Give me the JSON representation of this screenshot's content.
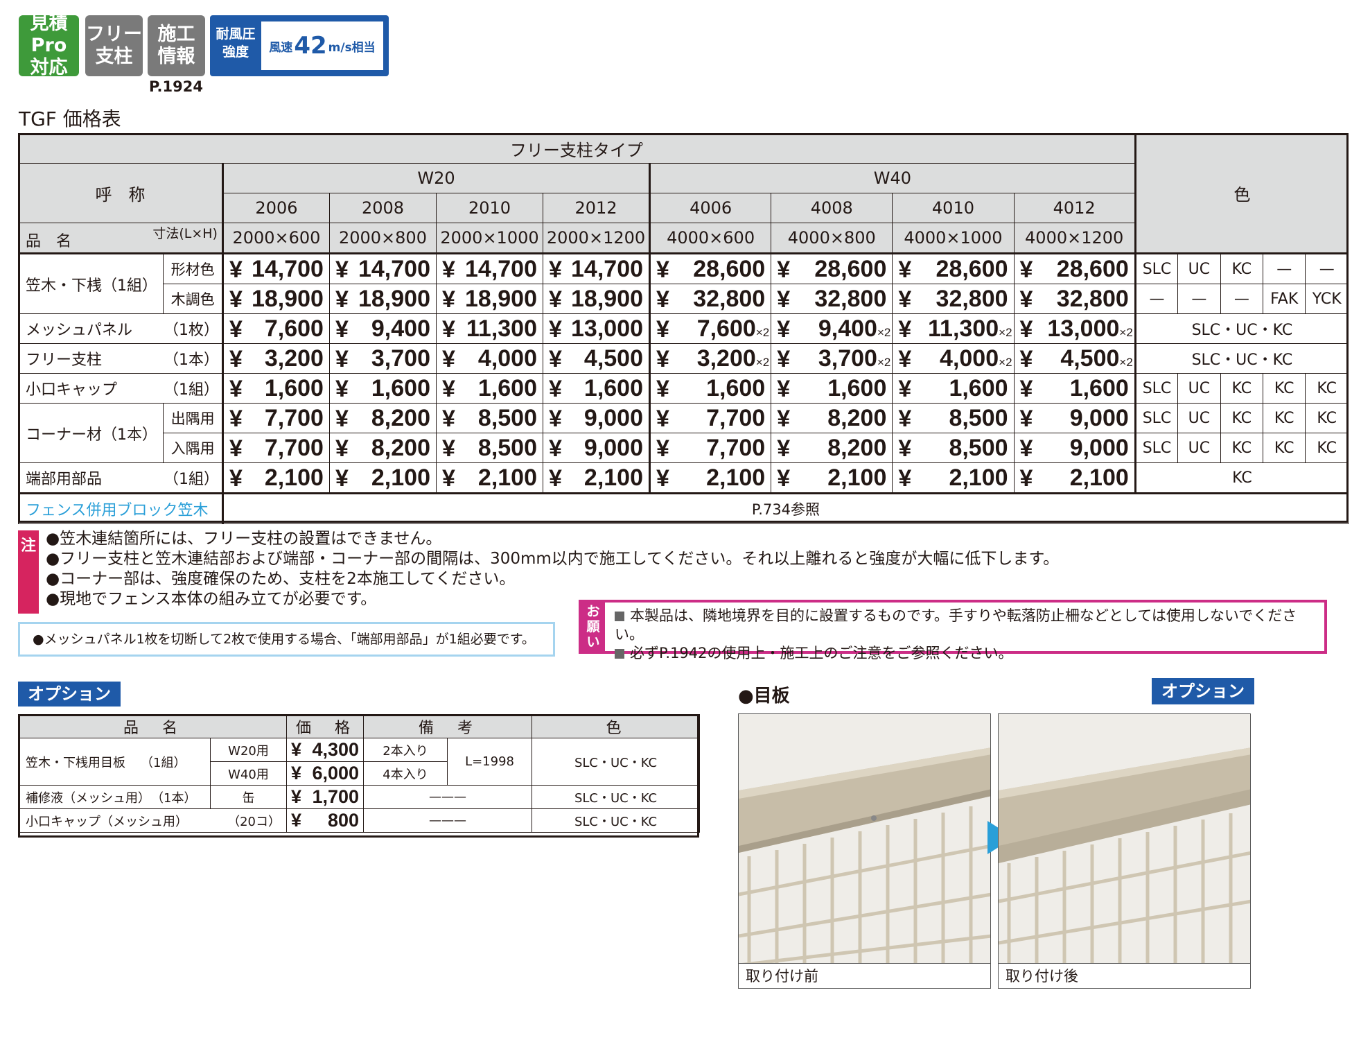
{
  "badges": {
    "mitsumori": "見積Pro\n対応",
    "free_post": "フリー\n支柱",
    "construction": "施工\n情報",
    "page_ref": "P.1924",
    "wind_label": "耐風圧\n強度",
    "wind_prefix": "風速",
    "wind_value": "42",
    "wind_suffix": "m/s相当"
  },
  "title": "TGF 価格表",
  "table": {
    "type_header": "フリー支柱タイプ",
    "name_header": "呼　称",
    "color_header": "色",
    "size_label": "寸法(L×H)",
    "item_label": "品　名",
    "groups": [
      "W20",
      "W40"
    ],
    "codes": [
      "2006",
      "2008",
      "2010",
      "2012",
      "4006",
      "4008",
      "4010",
      "4012"
    ],
    "sizes": [
      "2000×600",
      "2000×800",
      "2000×1000",
      "2000×1200",
      "4000×600",
      "4000×800",
      "4000×1000",
      "4000×1200"
    ],
    "yen": "¥",
    "x2": "×2",
    "rows": [
      {
        "name": "笠木・下桟（1組）",
        "sub": "形材色",
        "prices": [
          "14,700",
          "14,700",
          "14,700",
          "14,700",
          "28,600",
          "28,600",
          "28,600",
          "28,600"
        ],
        "colors": [
          "SLC",
          "UC",
          "KC",
          "—",
          "—"
        ]
      },
      {
        "name": "",
        "sub": "木調色",
        "prices": [
          "18,900",
          "18,900",
          "18,900",
          "18,900",
          "32,800",
          "32,800",
          "32,800",
          "32,800"
        ],
        "colors": [
          "—",
          "—",
          "—",
          "FAK",
          "YCK"
        ]
      },
      {
        "name": "メッシュパネル",
        "qty": "（1枚）",
        "prices": [
          "7,600",
          "9,400",
          "11,300",
          "13,000",
          "7,600",
          "9,400",
          "11,300",
          "13,000"
        ],
        "colors_all": "SLC・UC・KC"
      },
      {
        "name": "フリー支柱",
        "qty": "（1本）",
        "prices": [
          "3,200",
          "3,700",
          "4,000",
          "4,500",
          "3,200",
          "3,700",
          "4,000",
          "4,500"
        ],
        "colors_all": "SLC・UC・KC"
      },
      {
        "name": "小口キャップ",
        "qty": "（1組）",
        "prices": [
          "1,600",
          "1,600",
          "1,600",
          "1,600",
          "1,600",
          "1,600",
          "1,600",
          "1,600"
        ],
        "colors": [
          "SLC",
          "UC",
          "KC",
          "KC",
          "KC"
        ]
      },
      {
        "name": "コーナー材（1本）",
        "sub": "出隅用",
        "prices": [
          "7,700",
          "8,200",
          "8,500",
          "9,000",
          "7,700",
          "8,200",
          "8,500",
          "9,000"
        ],
        "colors": [
          "SLC",
          "UC",
          "KC",
          "KC",
          "KC"
        ]
      },
      {
        "name": "",
        "sub": "入隅用",
        "prices": [
          "7,700",
          "8,200",
          "8,500",
          "9,000",
          "7,700",
          "8,200",
          "8,500",
          "9,000"
        ],
        "colors": [
          "SLC",
          "UC",
          "KC",
          "KC",
          "KC"
        ]
      },
      {
        "name": "端部用部品",
        "qty": "（1組）",
        "prices": [
          "2,100",
          "2,100",
          "2,100",
          "2,100",
          "2,100",
          "2,100",
          "2,100",
          "2,100"
        ],
        "colors_all": "KC"
      }
    ],
    "block_link": "フェンス併用ブロック笠木",
    "block_ref": "P.734参照"
  },
  "notes": {
    "tag": "注",
    "items": [
      "●笠木連結箇所には、フリー支柱の設置はできません。",
      "●フリー支柱と笠木連結部および端部・コーナー部の間隔は、300mm以内で施工してください。それ以上離れると強度が大幅に低下します。",
      "●コーナー部は、強度確保のため、支柱を2本施工してください。",
      "●現地でフェンス本体の組み立てが必要です。"
    ],
    "box": "●メッシュパネル1枚を切断して2枚で使用する場合、「端部用部品」が1組必要です。"
  },
  "request": {
    "tag": "お願い",
    "items": [
      "本製品は、隣地境界を目的に設置するものです。手すりや転落防止柵などとしては使用しないでください。",
      "必ずP.1942の使用上・施工上のご注意をご参照ください。"
    ]
  },
  "option": {
    "title": "オプション",
    "headers": [
      "品　名",
      "価　格",
      "備　考",
      "色"
    ],
    "row1_name": "笠木・下桟用目板",
    "row1_qty": "（1組）",
    "row1_a_sub": "W20用",
    "row1_a_price": "4,300",
    "row1_a_note": "2本入り",
    "row1_b_sub": "W40用",
    "row1_b_price": "6,000",
    "row1_b_note": "4本入り",
    "row1_len": "L=1998",
    "row1_color": "SLC・UC・KC",
    "row2_name": "補修液（メッシュ用）",
    "row2_qty": "（1本）",
    "row2_sub": "缶",
    "row2_price": "1,700",
    "row2_note": "———",
    "row2_color": "SLC・UC・KC",
    "row3_name": "小口キャップ（メッシュ用）",
    "row3_qty": "（20コ）",
    "row3_price": "800",
    "row3_note": "———",
    "row3_color": "SLC・UC・KC"
  },
  "meita": {
    "title": "●目板",
    "option_label": "オプション",
    "before": "取り付け前",
    "after": "取り付け後"
  }
}
